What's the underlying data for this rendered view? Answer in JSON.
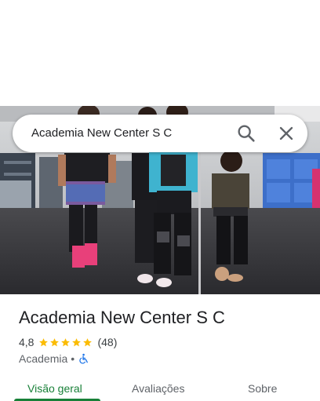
{
  "search": {
    "value": "Academia New Center S C"
  },
  "place": {
    "name": "Academia New Center S C",
    "rating": "4,8",
    "rating_value": 4.8,
    "review_count": "(48)",
    "category": "Academia",
    "separator": "•"
  },
  "tabs": [
    {
      "label": "Visão geral",
      "active": true
    },
    {
      "label": "Avaliações",
      "active": false
    },
    {
      "label": "Sobre",
      "active": false
    }
  ],
  "colors": {
    "accent": "#1a73e8",
    "star": "#fbbc04",
    "teal_tab": "#188038"
  },
  "icons": {
    "search": "search-icon",
    "close": "close-icon",
    "accessibility": "wheelchair-accessible-icon"
  }
}
